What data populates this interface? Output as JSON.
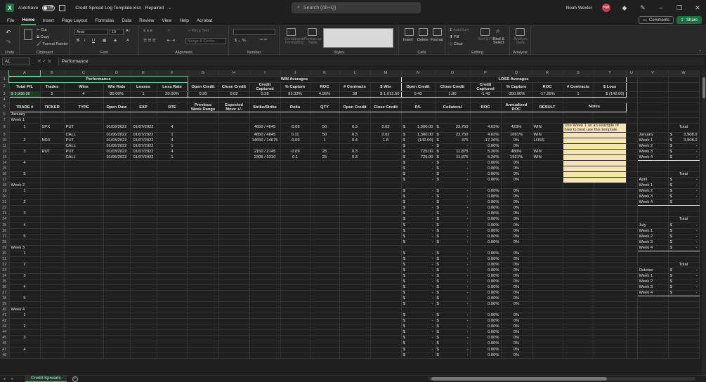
{
  "titlebar": {
    "autosave_label": "AutoSave",
    "autosave_state": "Off",
    "title": "Credit Spread Log Template.xlsx  -  Repaired",
    "search_placeholder": "Search (Alt+Q)",
    "user_name": "Noah Wexler",
    "user_initials": "NW"
  },
  "menu": [
    "File",
    "Home",
    "Insert",
    "Page Layout",
    "Formulas",
    "Data",
    "Review",
    "View",
    "Help",
    "Acrobat"
  ],
  "menu_active": "Home",
  "menu_buttons": {
    "comments": "Comments",
    "share": "Share"
  },
  "ribbon": {
    "undo_label": "Undo",
    "clipboard": {
      "cut": "Cut",
      "copy": "Copy",
      "format_painter": "Format Painter",
      "label": "Clipboard"
    },
    "font": {
      "name": "Arial",
      "size": "10",
      "label": "Font"
    },
    "alignment": {
      "wrap": "Wrap Text",
      "merge": "Merge & Center",
      "label": "Alignment"
    },
    "number": {
      "label": "Number"
    },
    "styles": {
      "cond": "Conditional Formatting",
      "table": "Format as Table",
      "label": "Styles"
    },
    "cells": {
      "insert": "Insert",
      "delete": "Delete",
      "format": "Format",
      "label": "Cells"
    },
    "editing": {
      "sum": "AutoSum",
      "fill": "Fill",
      "clear": "Clear",
      "sort": "Sort & Filter",
      "find": "Find & Select",
      "label": "Editing"
    },
    "analysis": {
      "analyze": "Analyze Data",
      "label": "Analysis"
    }
  },
  "formula_bar": {
    "name_box": "A1",
    "fx": "fx",
    "content": "Performance"
  },
  "columns": [
    "A",
    "B",
    "C",
    "D",
    "E",
    "F",
    "G",
    "H",
    "I",
    "J",
    "K",
    "L",
    "M",
    "N",
    "O",
    "P",
    "Q",
    "R",
    "S",
    "T",
    "U",
    "V",
    "W"
  ],
  "sections": {
    "performance": "Performance",
    "win_avg": "WIN Averages",
    "loss_avg": "LOSS Averages"
  },
  "perf_headers": [
    "Total P/L",
    "Trades",
    "Wins",
    "Win Rate",
    "Losses",
    "Loss Rate",
    "Open Credit",
    "Close Credit",
    "Credit Captured",
    "% Capture",
    "ROC",
    "# Contracts",
    "$ Win",
    "Open Credit",
    "Close Credit",
    "Credit Captured",
    "% Capture",
    "ROC",
    "# Contracts",
    "$ Loss"
  ],
  "perf_values": [
    "$     3,908.00",
    "5",
    "4",
    "80.00%",
    "1",
    "20.00%",
    "0.30",
    "0.02",
    "0.28",
    "93.33%",
    "4.95%",
    "38",
    "$     1,012.50",
    "0.40",
    "1.80",
    "-1.40",
    "-350.00%",
    "-17.26%",
    "1",
    "$    (142.00)"
  ],
  "log_headers": [
    "TRADE #",
    "TICKER",
    "TYPE",
    "Open Date",
    "EXP",
    "DTE",
    "Previous Week Range",
    "Expected Move +/-",
    "Strike/Strike",
    "Delta",
    "QTY",
    "Open Credit",
    "Close Credit",
    "P/L",
    "Collateral",
    "ROC",
    "Annualized ROC",
    "RESULT",
    "Notes"
  ],
  "month_label": "January",
  "note_text": "Use Week 1 as an example of how to best use this template",
  "weeks": [
    "Week 1",
    "Week 2",
    "Week 3",
    "Week 4"
  ],
  "trades": [
    {
      "num": "1",
      "ticker": "SPX",
      "type": "PUT",
      "open": "01/03/2022",
      "exp": "01/07/2022",
      "dte": "4",
      "strike": "4650 / 4645",
      "delta": "-0.09",
      "qty": "50",
      "oc": "0.3",
      "cc": "0.02",
      "pl": "1,300.00",
      "coll": "23,750",
      "roc": "4.63%",
      "aroc": "423%",
      "res": "WIN"
    },
    {
      "num": "",
      "ticker": "",
      "type": "CALL",
      "open": "01/06/2022",
      "exp": "01/07/2022",
      "dte": "1",
      "strike": "4850 / 4845",
      "delta": "0.11",
      "qty": "50",
      "oc": "0.3",
      "cc": "0.02",
      "pl": "1,300.00",
      "coll": "23,750",
      "roc": "4.63%",
      "aroc": "1691%",
      "res": "WIN"
    },
    {
      "num": "2",
      "ticker": "NDX",
      "type": "PUT",
      "open": "01/03/2022",
      "exp": "01/07/2022",
      "dte": "4",
      "strike": "14650 / 14675",
      "delta": "-0.09",
      "qty": "1",
      "oc": "0.4",
      "cc": "1.8",
      "pl": "(142.00)",
      "coll": "475",
      "roc": "-17.26%",
      "aroc": "0%",
      "res": "LOSS"
    },
    {
      "num": "",
      "ticker": "",
      "type": "CALL",
      "open": "01/06/2022",
      "exp": "01/07/2022",
      "dte": "1",
      "strike": "",
      "delta": "",
      "qty": "",
      "oc": "",
      "cc": "",
      "pl": "-",
      "coll": "-",
      "roc": "0.00%",
      "aroc": "0%",
      "res": ""
    },
    {
      "num": "3",
      "ticker": "RUT",
      "type": "PUT",
      "open": "01/03/2022",
      "exp": "01/07/2022",
      "dte": "4",
      "strike": "2150 / 2145",
      "delta": "-0.09",
      "qty": "25",
      "oc": "0.3",
      "cc": "",
      "pl": "725.00",
      "coll": "11,875",
      "roc": "5.26%",
      "aroc": "480%",
      "res": "WIN"
    },
    {
      "num": "",
      "ticker": "",
      "type": "CALL",
      "open": "01/06/2022",
      "exp": "01/07/2022",
      "dte": "1",
      "strike": "2305 / 2310",
      "delta": "0.1",
      "qty": "25",
      "oc": "0.3",
      "cc": "",
      "pl": "725.00",
      "coll": "11,875",
      "roc": "5.26%",
      "aroc": "1921%",
      "res": "WIN"
    }
  ],
  "empty": {
    "dollar": "$",
    "dash": "-",
    "roc": "0.00%",
    "aroc": "0%"
  },
  "summary": {
    "total_label": "Total",
    "blocks": [
      {
        "rows": [
          {
            "label": "January",
            "d": "$",
            "v": "3,908.0"
          },
          {
            "label": "Week 1",
            "d": "$",
            "v": "3,908.0"
          },
          {
            "label": "Week 2",
            "d": "$",
            "v": "-"
          },
          {
            "label": "Week 3",
            "d": "$",
            "v": "-"
          },
          {
            "label": "Week 4",
            "d": "$",
            "v": "-"
          }
        ]
      },
      {
        "rows": [
          {
            "label": "April",
            "d": "$",
            "v": "-"
          },
          {
            "label": "Week 1",
            "d": "$",
            "v": "-"
          },
          {
            "label": "Week 2",
            "d": "$",
            "v": "-"
          },
          {
            "label": "Week 3",
            "d": "$",
            "v": "-"
          },
          {
            "label": "Week 4",
            "d": "$",
            "v": "-"
          }
        ]
      },
      {
        "rows": [
          {
            "label": "July",
            "d": "$",
            "v": "-"
          },
          {
            "label": "Week 1",
            "d": "$",
            "v": "-"
          },
          {
            "label": "Week 2",
            "d": "$",
            "v": "-"
          },
          {
            "label": "Week 3",
            "d": "$",
            "v": "-"
          },
          {
            "label": "Week 4",
            "d": "$",
            "v": "-"
          }
        ]
      },
      {
        "rows": [
          {
            "label": "October",
            "d": "$",
            "v": "-"
          },
          {
            "label": "Week 1",
            "d": "$",
            "v": "-"
          },
          {
            "label": "Week 2",
            "d": "$",
            "v": "-"
          },
          {
            "label": "Week 3",
            "d": "$",
            "v": "-"
          },
          {
            "label": "Week 4",
            "d": "$",
            "v": "-"
          }
        ]
      }
    ]
  },
  "sheet_tab": "Credit Spreads"
}
